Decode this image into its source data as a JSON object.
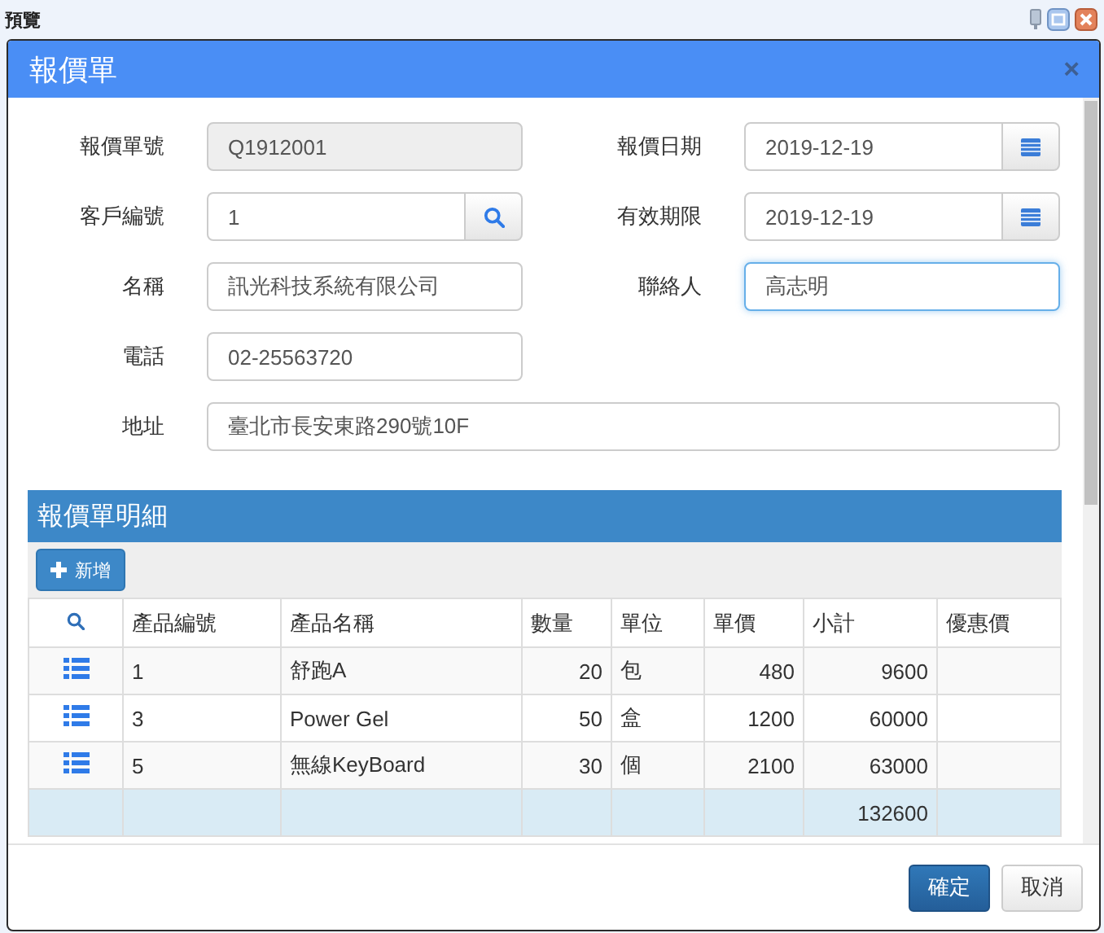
{
  "window": {
    "title": "預覽"
  },
  "dialog": {
    "title": "報價單",
    "close": "×"
  },
  "form_rows": [
    [
      {
        "label": "報價單號",
        "value": "Q1912001",
        "kind": "text",
        "readonly": true,
        "focused": false,
        "wide": false
      },
      {
        "label": "報價日期",
        "value": "2019-12-19",
        "kind": "date",
        "readonly": false,
        "focused": false,
        "wide": false
      }
    ],
    [
      {
        "label": "客戶編號",
        "value": "1",
        "kind": "lookup",
        "readonly": false,
        "focused": false,
        "wide": false
      },
      {
        "label": "有效期限",
        "value": "2019-12-19",
        "kind": "date",
        "readonly": false,
        "focused": false,
        "wide": false
      }
    ],
    [
      {
        "label": "名稱",
        "value": "訊光科技系統有限公司",
        "kind": "text",
        "readonly": false,
        "focused": false,
        "wide": false
      },
      {
        "label": "聯絡人",
        "value": "高志明",
        "kind": "text",
        "readonly": false,
        "focused": true,
        "wide": false
      }
    ],
    [
      {
        "label": "電話",
        "value": "02-25563720",
        "kind": "text",
        "readonly": false,
        "focused": false,
        "wide": false
      }
    ],
    [
      {
        "label": "地址",
        "value": "臺北市長安東路290號10F",
        "kind": "text",
        "readonly": false,
        "focused": false,
        "wide": true
      }
    ]
  ],
  "detail": {
    "title": "報價單明細",
    "add_button": "新增",
    "columns": [
      {
        "label": "產品編號",
        "kind": "text",
        "summed": false
      },
      {
        "label": "產品名稱",
        "kind": "text",
        "summed": false
      },
      {
        "label": "數量",
        "kind": "number",
        "summed": false
      },
      {
        "label": "單位",
        "kind": "text",
        "summed": false
      },
      {
        "label": "單價",
        "kind": "number",
        "summed": false
      },
      {
        "label": "小計",
        "kind": "number",
        "summed": true
      },
      {
        "label": "優惠價",
        "kind": "number",
        "summed": false
      }
    ],
    "rows": [
      [
        "1",
        "舒跑A",
        "20",
        "包",
        "480",
        "9600"
      ],
      [
        "3",
        "Power Gel",
        "50",
        "盒",
        "1200",
        "60000"
      ],
      [
        "5",
        "無線KeyBoard",
        "30",
        "個",
        "2100",
        "63000"
      ]
    ],
    "total": "132600"
  },
  "buttons": [
    {
      "label": "確定",
      "kind": "primary"
    },
    {
      "label": "取消",
      "kind": "default"
    }
  ]
}
